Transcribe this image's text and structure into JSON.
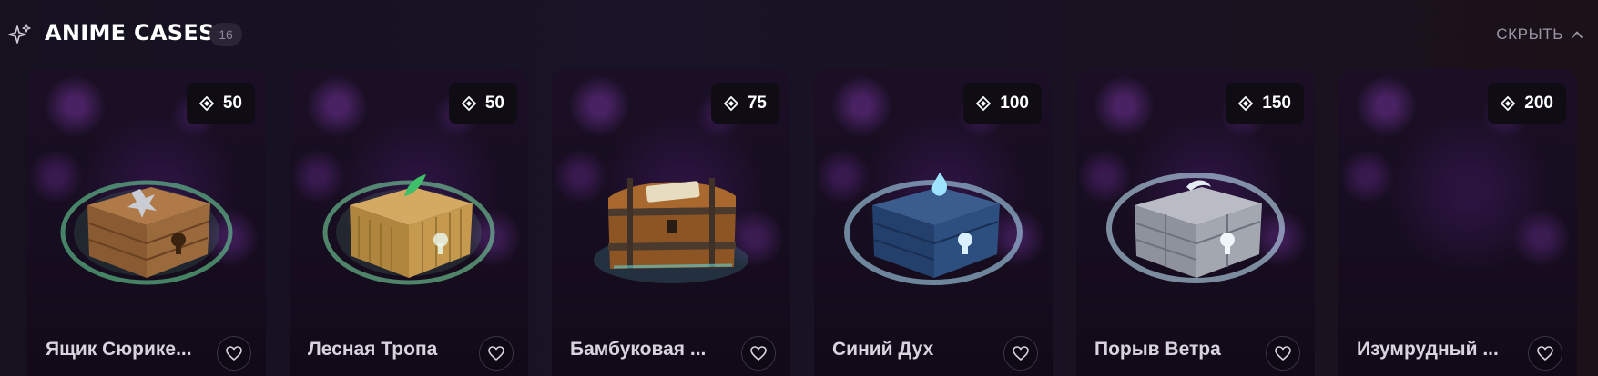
{
  "header": {
    "title": "ANIME CASES",
    "count": "16",
    "hide_label": "СКРЫТЬ",
    "icons": {
      "section": "sparkle-icon",
      "hide": "chevron-up-icon"
    }
  },
  "cards": [
    {
      "name": "Ящик Сюрике...",
      "price": "50",
      "chest_style": "wood-shuriken",
      "aura": "#6fe6a0"
    },
    {
      "name": "Лесная Тропа",
      "price": "50",
      "chest_style": "bamboo-leaf",
      "aura": "#7fe8a8"
    },
    {
      "name": "Бамбуковая ...",
      "price": "75",
      "chest_style": "wood-scroll",
      "aura": "#5fd6d6"
    },
    {
      "name": "Синий Дух",
      "price": "100",
      "chest_style": "blue-spirit",
      "aura": "#a8d8f0"
    },
    {
      "name": "Порыв Ветра",
      "price": "150",
      "chest_style": "stone-wind",
      "aura": "#bfe2f5"
    },
    {
      "name": "Изумрудный ...",
      "price": "200",
      "chest_style": "empty",
      "aura": ""
    }
  ],
  "colors": {
    "background": "#17121f",
    "card_background": "#170d20",
    "badge_background": "#0f0c14",
    "muted_text": "#9b96a6"
  }
}
